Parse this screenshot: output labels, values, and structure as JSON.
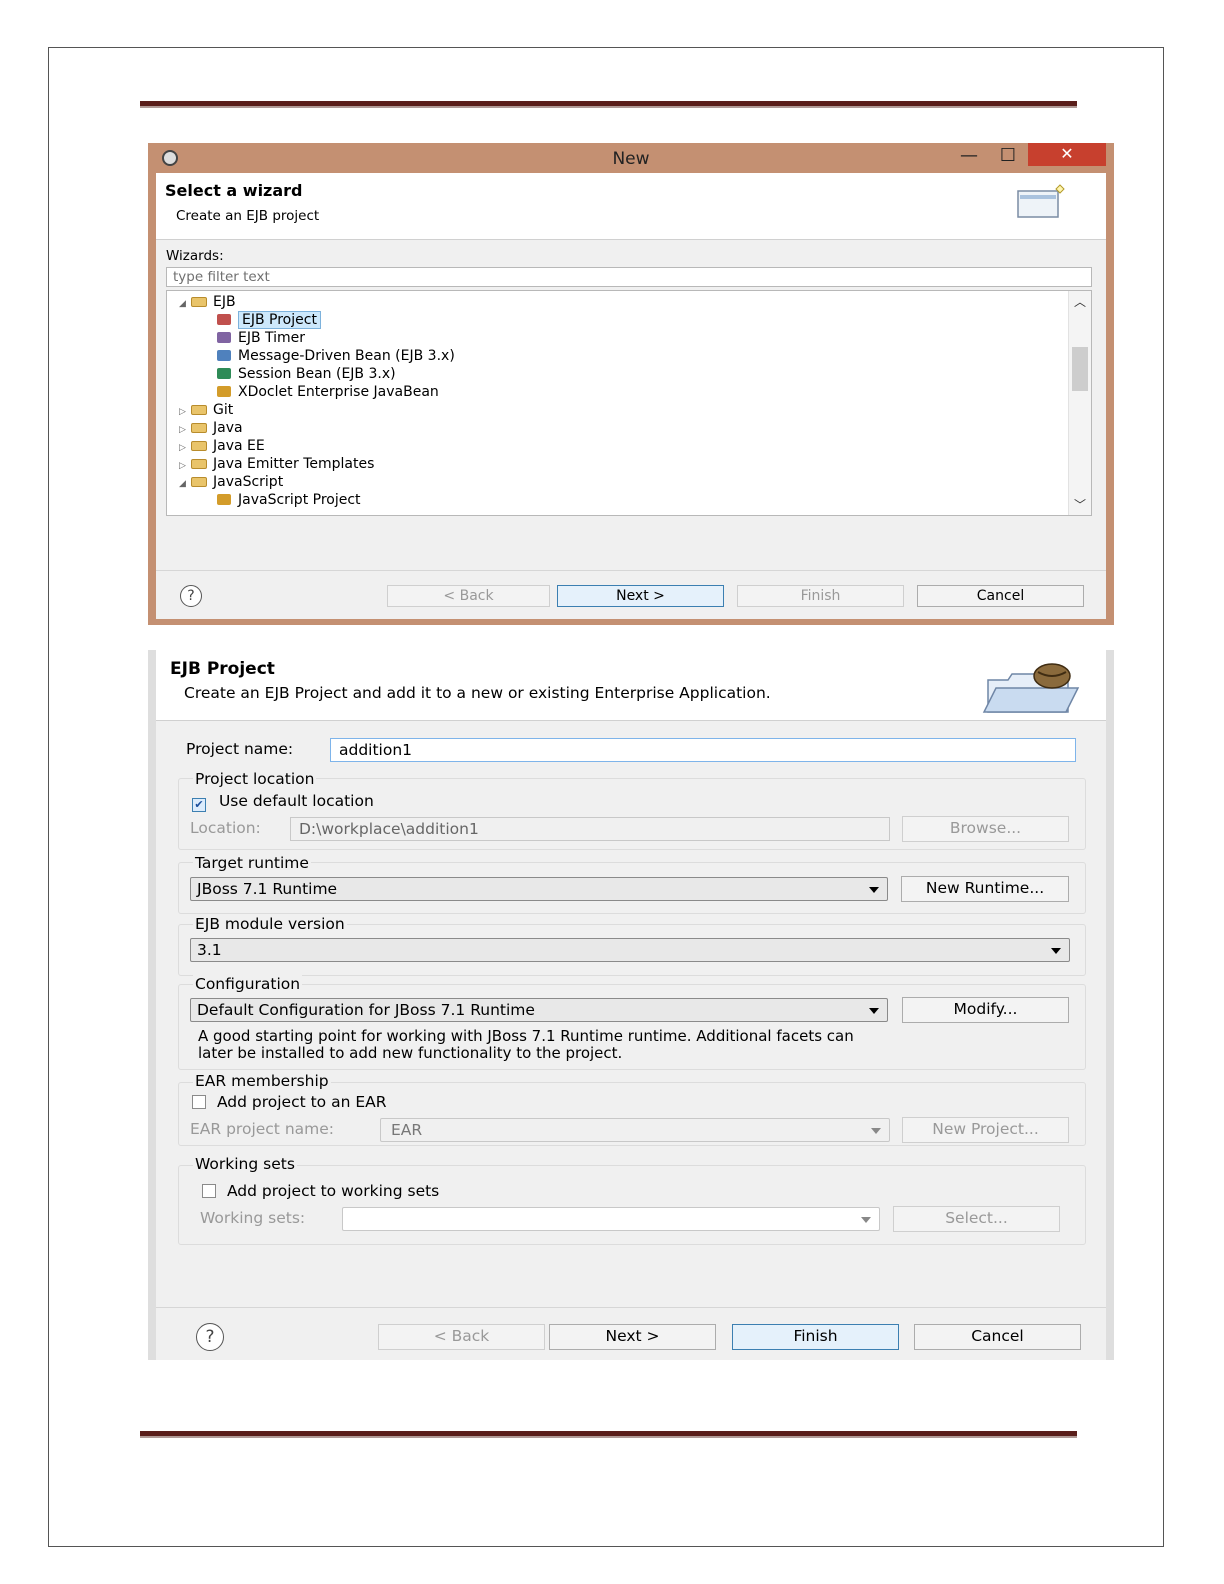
{
  "wizard_new": {
    "title": "New",
    "header_title": "Select a wizard",
    "header_desc": "Create an EJB project",
    "wizards_label": "Wizards:",
    "filter_placeholder": "type filter text",
    "tree": [
      {
        "label": "EJB",
        "level": 0,
        "kind": "folder",
        "expanded": true
      },
      {
        "label": "EJB Project",
        "level": 1,
        "kind": "item",
        "selected": true
      },
      {
        "label": "EJB Timer",
        "level": 1,
        "kind": "item"
      },
      {
        "label": "Message-Driven Bean (EJB 3.x)",
        "level": 1,
        "kind": "item"
      },
      {
        "label": "Session Bean (EJB 3.x)",
        "level": 1,
        "kind": "item"
      },
      {
        "label": "XDoclet Enterprise JavaBean",
        "level": 1,
        "kind": "item"
      },
      {
        "label": "Git",
        "level": 0,
        "kind": "folder",
        "expanded": false
      },
      {
        "label": "Java",
        "level": 0,
        "kind": "folder",
        "expanded": false
      },
      {
        "label": "Java EE",
        "level": 0,
        "kind": "folder",
        "expanded": false
      },
      {
        "label": "Java Emitter Templates",
        "level": 0,
        "kind": "folder",
        "expanded": false
      },
      {
        "label": "JavaScript",
        "level": 0,
        "kind": "folder",
        "expanded": true
      },
      {
        "label": "JavaScript Project",
        "level": 1,
        "kind": "item"
      }
    ],
    "buttons": {
      "back": "< Back",
      "next": "Next >",
      "finish": "Finish",
      "cancel": "Cancel"
    },
    "help_glyph": "?",
    "icons": {
      "app": "eclipse-icon",
      "minimize": "minimize-icon",
      "maximize": "maximize-icon",
      "close": "close-icon"
    }
  },
  "wizard_ejb": {
    "header_title": "EJB Project",
    "header_desc": "Create an EJB Project and add it to a new or existing Enterprise Application.",
    "project_name_label": "Project name:",
    "project_name_value": "addition1",
    "project_location": {
      "legend": "Project location",
      "use_default_label": "Use default location",
      "use_default_checked": true,
      "location_label": "Location:",
      "location_value": "D:\\workplace\\addition1",
      "browse_label": "Browse..."
    },
    "target_runtime": {
      "legend": "Target runtime",
      "value": "JBoss 7.1 Runtime",
      "new_runtime_label": "New Runtime..."
    },
    "ejb_module_version": {
      "legend": "EJB module version",
      "value": "3.1"
    },
    "configuration": {
      "legend": "Configuration",
      "value": "Default Configuration for JBoss 7.1 Runtime",
      "modify_label": "Modify...",
      "description_line1": "A good starting point for working with JBoss 7.1 Runtime runtime. Additional facets can",
      "description_line2": "later be installed to add new functionality to the project."
    },
    "ear_membership": {
      "legend": "EAR membership",
      "add_label": "Add project to an EAR",
      "add_checked": false,
      "name_label": "EAR project name:",
      "name_value": "EAR",
      "new_project_label": "New Project..."
    },
    "working_sets": {
      "legend": "Working sets",
      "add_label": "Add project to working sets",
      "add_checked": false,
      "sets_label": "Working sets:",
      "sets_value": "",
      "select_label": "Select..."
    },
    "buttons": {
      "back": "< Back",
      "next": "Next >",
      "finish": "Finish",
      "cancel": "Cancel"
    },
    "help_glyph": "?"
  },
  "colors": {
    "titlebar": "#c49072",
    "close": "#c7402e",
    "rule": "#5a1e1a"
  }
}
